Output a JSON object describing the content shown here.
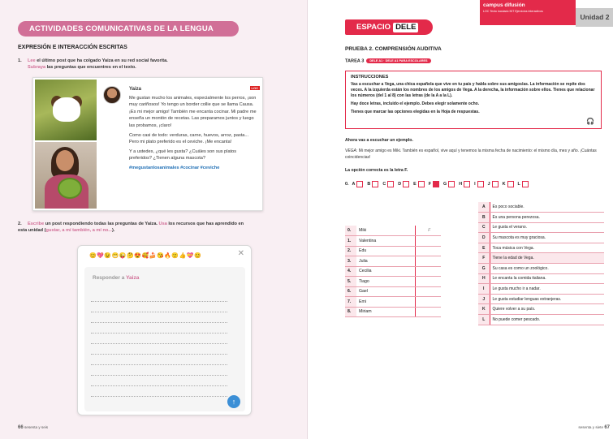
{
  "left": {
    "banner": "ACTIVIDADES COMUNICATIVAS DE LA LENGUA",
    "section_title": "EXPRESIÓN E INTERACCIÓN ESCRITAS",
    "task1": {
      "num": "1.",
      "verb1": "Lee",
      "text1": " el último post que ha colgado Yaiza en su red social favorita.",
      "verb2": "Subraya",
      "text2": " las preguntas que encuentres en el texto."
    },
    "post": {
      "name": "Yaiza",
      "loc_badge": "LOC",
      "p1": "Me gustan mucho los animales, especialmente los perros, ¡son muy cariñosos! Yo tengo un border collie que se llama Causa. ¡Es mi mejor amigo! También me encanta cocinar. Mi padre me enseña un montón de recetas. Las preparamos juntos y luego las probamos, ¡claro!",
      "p2": "Como casi de todo: verduras, carne, huevos, arroz, pasta... Pero mi plato preferido es el ceviche. ¡Me encanta!",
      "p3": "Y a ustedes, ¿qué les gusta? ¿Cuáles son sus platos preferidos? ¿Tienen alguna mascota?",
      "tags": "#megustanlosanimales #cocinar #ceviche"
    },
    "task2": {
      "num": "2.",
      "verb1": "Escribe",
      "text1": " un post respondiendo todas las preguntas de Yaiza. ",
      "verb2": "Usa",
      "text2": " los recursos que has aprendido en esta unidad (",
      "res": "gustar, a mí también, a mí no...",
      "text3": ")."
    },
    "reply": {
      "emojis": "😊💖😉😁😜🤔😍🥰🍰😘🔥🙂👍💝😊",
      "close": "✕",
      "label_prefix": "Responder a ",
      "label_name": "Yaiza",
      "send": "↑"
    },
    "page_number": "66",
    "page_words": "sesenta y seis"
  },
  "right": {
    "espacio": "ESPACIO",
    "dele": "DELE",
    "campus_title": "campus difusión",
    "campus_sub": "LOC Texto locutado  INT Ejercicios interactivos",
    "unidad": "Unidad 2",
    "prueba": "PRUEBA 2. COMPRENSIÓN AUDITIVA",
    "tarea": "TAREA 3",
    "tarea_badge": "DELE A1 · DELE A1 PARA ESCOLARES",
    "instr_title": "INSTRUCCIONES",
    "instr_p1": "Vas a escuchar a Vega, una chica española que vive en tu país y habla sobre sus amigos/as. La información se repite dos veces. A la izquierda están los nombres de los amigos de Vega. A la derecha, la información sobre ellos. Tienes que relacionar los números (del 1 al 8) con las letras (de la A a la L).",
    "instr_p2": "Hay doce letras, incluido el ejemplo. Debes elegir solamente ocho.",
    "instr_p3": "Tienes que marcar las opciones elegidas en la Hoja de respuestas.",
    "headphones": "🎧",
    "ahora": "Ahora vas a escuchar un ejemplo.",
    "example_speaker": "VEGA:",
    "example_text": " Mi mejor amigo es Miki. También es español, vive aquí y tenemos la misma fecha de nacimiento: el mismo día, mes y año. ¡Cuántas coincidencias!",
    "correcta": "La opción correcta es la letra F.",
    "answer_label": "0.",
    "answer_letters": [
      "A",
      "B",
      "C",
      "D",
      "E",
      "F",
      "G",
      "H",
      "I",
      "J",
      "K",
      "L"
    ],
    "answer_selected": "F",
    "friends": [
      {
        "n": "0.",
        "name": "Miki",
        "ans": "F"
      },
      {
        "n": "1.",
        "name": "Valentina",
        "ans": ""
      },
      {
        "n": "2.",
        "name": "Edu",
        "ans": ""
      },
      {
        "n": "3.",
        "name": "Julia",
        "ans": ""
      },
      {
        "n": "4.",
        "name": "Cecilia",
        "ans": ""
      },
      {
        "n": "5.",
        "name": "Tiago",
        "ans": ""
      },
      {
        "n": "6.",
        "name": "Gael",
        "ans": ""
      },
      {
        "n": "7.",
        "name": "Emi",
        "ans": ""
      },
      {
        "n": "8.",
        "name": "Miriam",
        "ans": ""
      }
    ],
    "options": [
      {
        "l": "A",
        "t": "Es poco sociable."
      },
      {
        "l": "B",
        "t": "Es una persona perezosa."
      },
      {
        "l": "C",
        "t": "Le gusta el verano."
      },
      {
        "l": "D",
        "t": "Su mascota es muy graciosa."
      },
      {
        "l": "E",
        "t": "Toca música con Vega."
      },
      {
        "l": "F",
        "t": "Tiene la edad de Vega."
      },
      {
        "l": "G",
        "t": "Su casa es como un zoológico."
      },
      {
        "l": "H",
        "t": "Le encanta la comida italiana."
      },
      {
        "l": "I",
        "t": "Le gusta mucho ir a nadar."
      },
      {
        "l": "J",
        "t": "Le gusta estudiar lenguas extranjeras."
      },
      {
        "l": "K",
        "t": "Quiere volver a su país."
      },
      {
        "l": "L",
        "t": "No puede comer pescado."
      }
    ],
    "page_number": "67",
    "page_words": "sesenta y siete"
  },
  "colors": {
    "accent_pink": "#d16f97",
    "accent_red": "#e32a4a",
    "link_blue": "#1f6fb5"
  }
}
